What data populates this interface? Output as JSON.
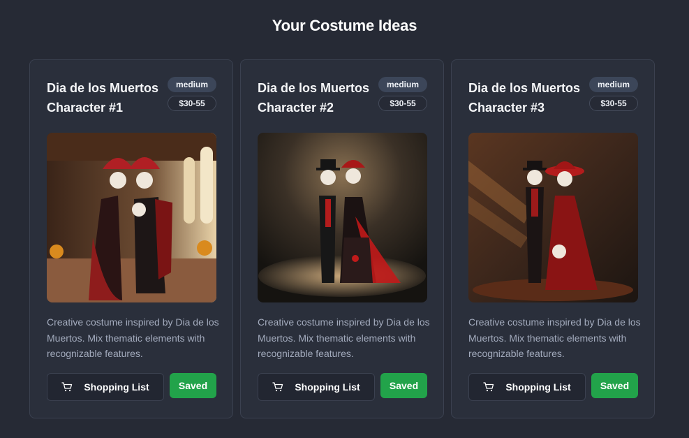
{
  "page": {
    "title": "Your Costume Ideas"
  },
  "cards": [
    {
      "name": "Dia de los Muertos Character #1",
      "difficulty": "medium",
      "price": "$30-55",
      "description": "Creative costume inspired by Dia de los Muertos. Mix thematic elements with recognizable features.",
      "shopping_label": "Shopping List",
      "saved_label": "Saved",
      "image_icon": "costume-photo"
    },
    {
      "name": "Dia de los Muertos Character #2",
      "difficulty": "medium",
      "price": "$30-55",
      "description": "Creative costume inspired by Dia de los Muertos. Mix thematic elements with recognizable features.",
      "shopping_label": "Shopping List",
      "saved_label": "Saved",
      "image_icon": "costume-photo"
    },
    {
      "name": "Dia de los Muertos Character #3",
      "difficulty": "medium",
      "price": "$30-55",
      "description": "Creative costume inspired by Dia de los Muertos. Mix thematic elements with recognizable features.",
      "shopping_label": "Shopping List",
      "saved_label": "Saved",
      "image_icon": "costume-photo"
    }
  ],
  "colors": {
    "background": "#262a35",
    "card": "#2a2f3b",
    "saved_green": "#22a34a",
    "badge": "#3c4659"
  }
}
